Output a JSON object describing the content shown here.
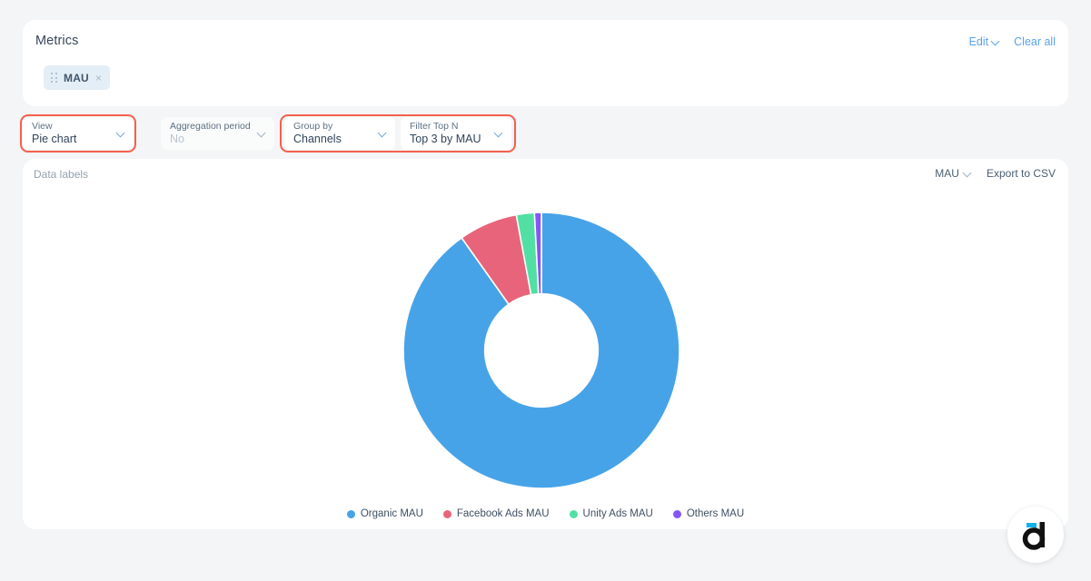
{
  "metrics_panel": {
    "title": "Metrics",
    "edit_label": "Edit",
    "clear_all_label": "Clear all",
    "chips": [
      {
        "label": "MAU",
        "remove_glyph": "×"
      }
    ]
  },
  "filter_bar": {
    "dropdowns": [
      {
        "label": "View",
        "value": "Pie chart",
        "disabled": false,
        "highlighted": true
      },
      {
        "label": "Aggregation period",
        "value": "No",
        "disabled": true,
        "highlighted": false
      },
      {
        "label": "Group by",
        "value": "Channels",
        "disabled": false,
        "highlighted": true
      },
      {
        "label": "Filter Top N",
        "value": "Top 3 by MAU",
        "disabled": false,
        "highlighted": true
      }
    ]
  },
  "chart_card": {
    "data_labels_toggle": "Data labels",
    "metric_selector": "MAU",
    "export_label": "Export to CSV"
  },
  "chart_data": {
    "type": "pie",
    "variant": "donut",
    "title": "",
    "legend_position": "bottom",
    "value_unit": "MAU",
    "categories": [
      "Organic MAU",
      "Facebook Ads MAU",
      "Unity Ads MAU",
      "Others MAU"
    ],
    "values": [
      90.2,
      6.9,
      2.1,
      0.8
    ],
    "percentages": [
      "90.2%",
      "6.9%",
      "2.1%",
      "0.8%"
    ],
    "slices": [
      {
        "label": "Organic MAU",
        "percent": 90.2,
        "color": "#47a3e8",
        "start_angle": 0.0,
        "sweep_angle": 324.7
      },
      {
        "label": "Facebook Ads MAU",
        "percent": 6.9,
        "color": "#e8647b",
        "start_angle": 324.7,
        "sweep_angle": 24.8
      },
      {
        "label": "Unity Ads MAU",
        "percent": 2.1,
        "color": "#52dfa4",
        "start_angle": 349.5,
        "sweep_angle": 7.6
      },
      {
        "label": "Others MAU",
        "percent": 0.8,
        "color": "#8257f5",
        "start_angle": 357.1,
        "sweep_angle": 2.9
      }
    ],
    "inner_radius_ratio": 0.41,
    "grid": false
  },
  "branding": {
    "logo_letter": "d"
  },
  "colors": {
    "accent_blue": "#5ba3e8",
    "highlight_red": "#f4604e",
    "page_bg": "#f4f5f6",
    "card_bg": "#ffffff",
    "chip_bg": "#e4eef6"
  }
}
